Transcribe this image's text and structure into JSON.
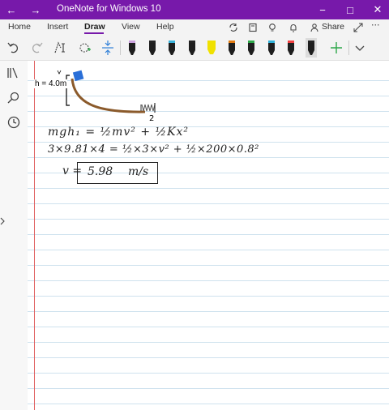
{
  "window": {
    "title": "OneNote for Windows 10"
  },
  "menu": {
    "home": "Home",
    "insert": "Insert",
    "draw": "Draw",
    "view": "View",
    "help": "Help",
    "share": "Share"
  },
  "pen_colors": [
    "#c9a0dc",
    "#222222",
    "#38b0d8",
    "#222222",
    "#f0e100",
    "#e07a10",
    "#2da84a",
    "#2fb0d8",
    "#f04040",
    "#222222"
  ],
  "page": {
    "height_label": "h = 4.0m",
    "point_label": "2",
    "eq1": "mgh₁ = ½mv² + ½Kx²",
    "eq2": "3×9.81×4 = ½×3×v² + ½×200×0.8²",
    "result_var": "v =",
    "result_value": "5.98",
    "result_unit": "m/s"
  }
}
